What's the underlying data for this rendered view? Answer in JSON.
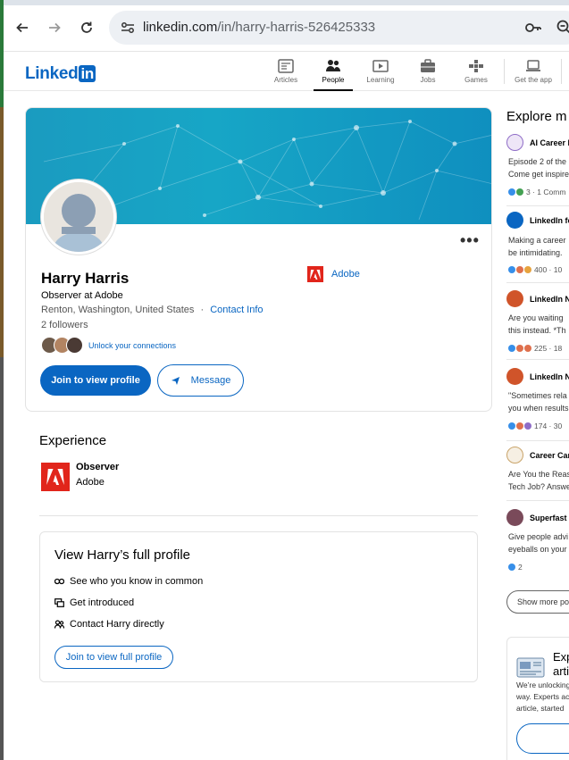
{
  "browser": {
    "url_host": "linkedin.com",
    "url_path": "/in/harry-harris-526425333"
  },
  "header": {
    "logo_text": "Linked",
    "logo_in": "in",
    "nav": [
      {
        "label": "Articles",
        "icon": "articles-icon"
      },
      {
        "label": "People",
        "icon": "people-icon"
      },
      {
        "label": "Learning",
        "icon": "learning-icon"
      },
      {
        "label": "Jobs",
        "icon": "jobs-icon"
      },
      {
        "label": "Games",
        "icon": "games-icon"
      },
      {
        "label": "Get the app",
        "icon": "get-app-icon"
      }
    ],
    "active_nav": "People"
  },
  "profile": {
    "name": "Harry Harris",
    "headline": "Observer at Adobe",
    "location": "Renton, Washington, United States",
    "location_sep": "·",
    "contact_info": "Contact Info",
    "followers": "2 followers",
    "unlock_connections": "Unlock your connections",
    "company": "Adobe",
    "join_button": "Join to view profile",
    "message_button": "Message",
    "more_menu": "•••"
  },
  "experience": {
    "title": "Experience",
    "items": [
      {
        "role": "Observer",
        "company": "Adobe"
      }
    ]
  },
  "full_profile": {
    "title": "View Harry’s full profile",
    "items": [
      {
        "label": "See who you know in common",
        "icon": "mutual-connections-icon"
      },
      {
        "label": "Get introduced",
        "icon": "introduce-icon"
      },
      {
        "label": "Contact Harry directly",
        "icon": "contact-icon"
      }
    ],
    "button": "Join to view full profile"
  },
  "right_column": {
    "title": "Explore m",
    "items": [
      {
        "name": "AI Career F",
        "line1": "Episode 2 of the",
        "line2": "Come get inspire",
        "reactions": "3 · 1 Comm",
        "icon_color": "#8f6dc7"
      },
      {
        "name": "LinkedIn fo",
        "line1": "Making a career",
        "line2": "be intimidating.",
        "reactions": "400 · 10",
        "icon_color": "#0a66c2"
      },
      {
        "name": "LinkedIn N",
        "line1": "Are you waiting",
        "line2": "this instead. *Th",
        "reactions": "225 · 18",
        "icon_color": "#d0542a"
      },
      {
        "name": "LinkedIn N",
        "line1": "\"Sometimes rela",
        "line2": "you when results",
        "reactions": "174 · 30",
        "icon_color": "#d0542a"
      },
      {
        "name": "Career Car",
        "line1": "Are You the Reas",
        "line2": "Tech Job? Answe",
        "reactions": "",
        "icon_color": "#c9a46a"
      },
      {
        "name": "Superfast I",
        "line1": "Give people advi",
        "line2": "eyeballs on your",
        "reactions": "2",
        "icon_color": "#7a4a5a"
      }
    ],
    "show_more": "Show more po",
    "expert_card": {
      "title_line1": "Exp",
      "title_line2": "arti",
      "text_line1": "We’re unlocking",
      "text_line2": "way. Experts ac",
      "text_line3": "article, started"
    }
  },
  "colors": {
    "brand": "#0a66c2",
    "adobe_red": "#e1251b"
  }
}
